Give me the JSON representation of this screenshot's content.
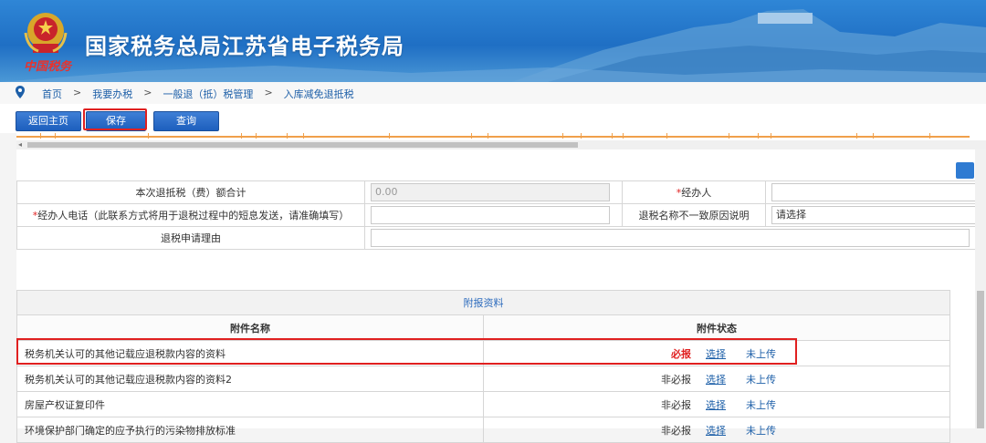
{
  "header": {
    "site_title": "国家税务总局江苏省电子税务局",
    "brand_text": "中国税务"
  },
  "breadcrumb": {
    "items": [
      "首页",
      "我要办税",
      "一般退（抵）税管理",
      "入库减免退抵税"
    ],
    "separator": ">"
  },
  "toolbar": {
    "back_label": "返回主页",
    "save_label": "保存",
    "query_label": "查询"
  },
  "form": {
    "row1": {
      "label": "本次退抵税（费）额合计",
      "value": "0.00",
      "right_req": "*",
      "right_label": "经办人",
      "right_value": ""
    },
    "row2": {
      "req": "*",
      "label": "经办人电话（此联系方式将用于退税过程中的短息发送，请准确填写）",
      "value": "",
      "right_label": "退税名称不一致原因说明",
      "right_value": "请选择"
    },
    "row3": {
      "label": "退税申请理由",
      "value": ""
    }
  },
  "attachments": {
    "title": "附报资料",
    "col_name": "附件名称",
    "col_status": "附件状态",
    "rows": [
      {
        "name": "税务机关认可的其他记载应退税款内容的资料",
        "required": "必报",
        "select": "选择",
        "upload": "未上传"
      },
      {
        "name": "税务机关认可的其他记载应退税款内容的资料2",
        "required": "非必报",
        "select": "选择",
        "upload": "未上传"
      },
      {
        "name": "房屋产权证复印件",
        "required": "非必报",
        "select": "选择",
        "upload": "未上传"
      },
      {
        "name": "环境保护部门确定的应予执行的污染物排放标准",
        "required": "非必报",
        "select": "选择",
        "upload": "未上传"
      }
    ]
  },
  "colors": {
    "header_blue": "#1f6fc4",
    "button_blue": "#2f6fcf",
    "highlight_red": "#e02020",
    "link_blue": "#1d5fa8"
  },
  "icons": [
    "emblem-icon",
    "location-pin-icon",
    "scroll-left-icon"
  ]
}
